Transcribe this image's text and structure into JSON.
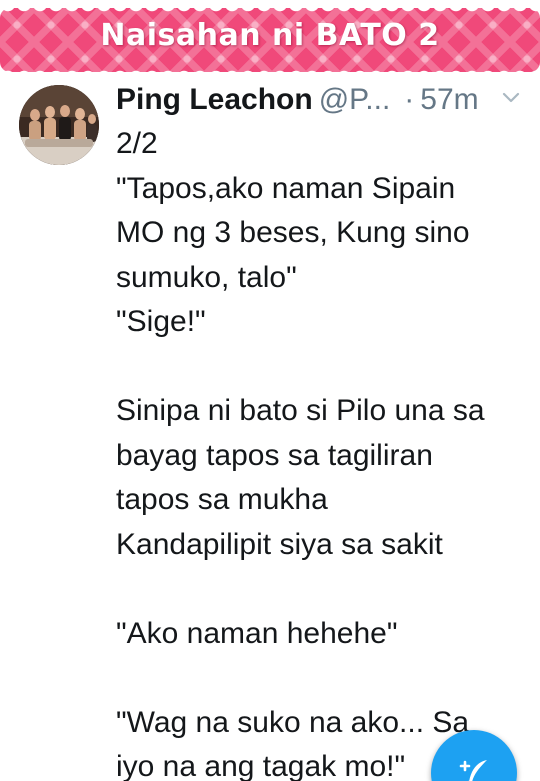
{
  "banner": {
    "title": "Naisahan ni BATO 2",
    "color": "#f0497a"
  },
  "tweet": {
    "author_name": "Ping Leachon",
    "author_handle": "@P...",
    "separator": "·",
    "time": "57m",
    "avatar_icon": "profile-photo",
    "menu_icon": "chevron-down-icon",
    "lines": [
      "2/2",
      "\"Tapos,ako naman Sipain",
      "MO ng 3 beses, Kung sino",
      "sumuko, talo\"",
      "\"Sige!\"",
      "",
      "Sinipa ni bato si Pilo una sa",
      "bayag tapos sa tagiliran",
      "tapos sa mukha",
      "Kandapilipit siya sa sakit",
      "",
      "\"Ako naman hehehe\"",
      "",
      "\"Wag na suko na ako... Sa",
      "iyo na ang tagak mo!\""
    ]
  },
  "compose_button": {
    "icon": "compose-feather-icon",
    "color": "#1da1f2"
  }
}
